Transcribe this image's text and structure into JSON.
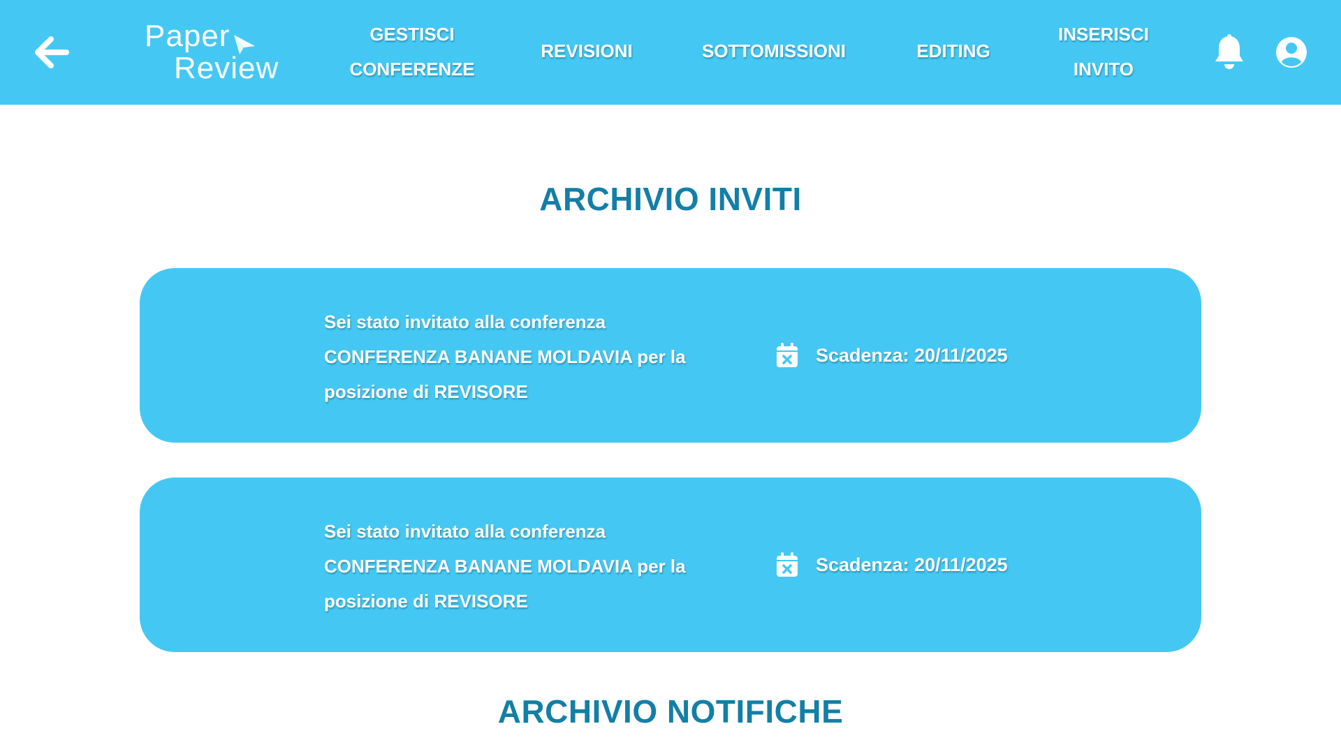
{
  "header": {
    "logo_line1": "Paper",
    "logo_line2": "Review",
    "nav": {
      "gestisci_line1": "GESTISCI",
      "gestisci_line2": "CONFERENZE",
      "revisioni": "REVISIONI",
      "sottomissioni": "SOTTOMISSIONI",
      "editing": "EDITING",
      "inserisci_line1": "INSERISCI",
      "inserisci_line2": "INVITO"
    },
    "icons": {
      "back": "arrow-left-icon",
      "notifications": "bell-icon",
      "profile": "user-circle-icon"
    }
  },
  "sections": {
    "inviti_title": "ARCHIVIO INVITI",
    "notifiche_title": "ARCHIVIO NOTIFICHE"
  },
  "invites": [
    {
      "line1": "Sei stato invitato  alla conferenza",
      "line2": "CONFERENZA BANANE MOLDAVIA per la",
      "line3": "posizione di REVISORE",
      "deadline": "Scadenza: 20/11/2025"
    },
    {
      "line1": "Sei stato invitato  alla conferenza",
      "line2": "CONFERENZA BANANE MOLDAVIA per la",
      "line3": "posizione di REVISORE",
      "deadline": "Scadenza: 20/11/2025"
    }
  ],
  "colors": {
    "brand": "#44c8f3",
    "title": "#137fa7",
    "text_on_brand": "#ffffff"
  }
}
